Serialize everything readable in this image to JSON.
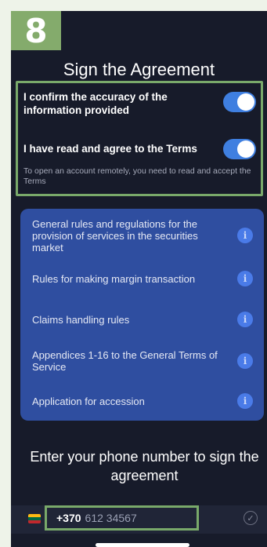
{
  "step_badge": "8",
  "title": "Sign the Agreement",
  "consents": [
    {
      "label": "I confirm the accuracy of the information provided",
      "checked": true
    },
    {
      "label": "I have read and agree to the Terms",
      "checked": true
    }
  ],
  "consent_note": "To open an account remotely, you need to read and accept the Terms",
  "documents": [
    {
      "label": "General rules and regulations for the provision of services in the securities market",
      "icon": "info-icon"
    },
    {
      "label": "Rules for making margin transaction",
      "icon": "info-icon"
    },
    {
      "label": "Claims handling rules",
      "icon": "info-icon"
    },
    {
      "label": "Appendices 1-16 to the General Terms of Service",
      "icon": "info-icon"
    },
    {
      "label": "Application for accession",
      "icon": "info-icon"
    }
  ],
  "sign_heading": "Enter your phone number to sign the agreement",
  "phone": {
    "country_code": "+370",
    "placeholder": "612 34567",
    "flag_colors": [
      "#fdb913",
      "#006a44",
      "#c1272d"
    ]
  },
  "colors": {
    "background": "#171b2a",
    "accent_toggle": "#3f7fe0",
    "docs_panel": "#2f4ea0",
    "highlight_border": "#79a96a"
  }
}
